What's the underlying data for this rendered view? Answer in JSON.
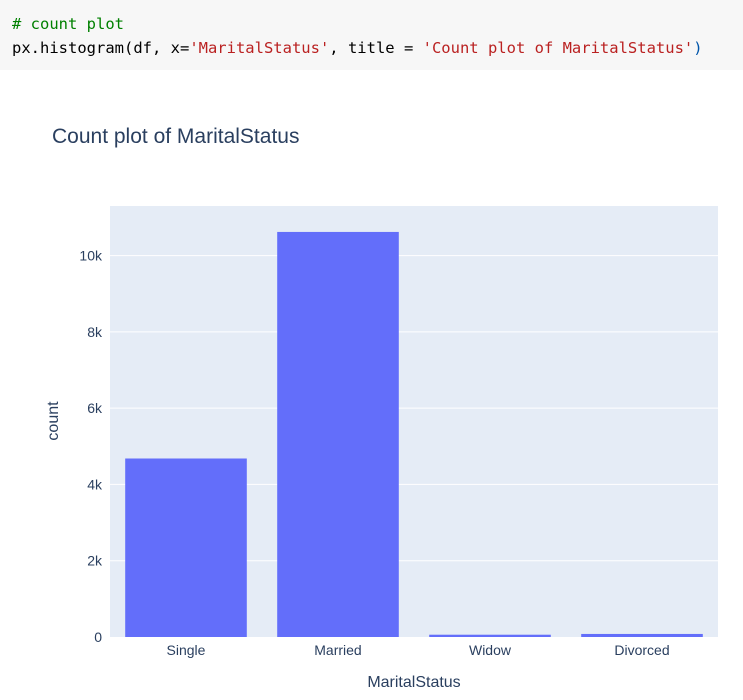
{
  "code": {
    "comment": "# count plot",
    "call_prefix": "px.histogram(df, x=",
    "x_arg": "'MaritalStatus'",
    "title_kw": ", title = ",
    "title_arg": "'Count plot of MaritalStatus'",
    "close_paren": ")"
  },
  "colors": {
    "bar": "#636efa",
    "plot_bg": "#e5ecf6",
    "grid": "#ffffff",
    "text": "#2a3f5f"
  },
  "chart_data": {
    "type": "bar",
    "title": "Count plot of MaritalStatus",
    "xlabel": "MaritalStatus",
    "ylabel": "count",
    "categories": [
      "Single",
      "Married",
      "Widow",
      "Divorced"
    ],
    "values": [
      4680,
      10620,
      60,
      80
    ],
    "ylim": [
      0,
      11300
    ],
    "yticks": [
      0,
      2000,
      4000,
      6000,
      8000,
      10000
    ],
    "ytick_labels": [
      "0",
      "2k",
      "4k",
      "6k",
      "8k",
      "10k"
    ],
    "grid": true,
    "legend": "none"
  }
}
